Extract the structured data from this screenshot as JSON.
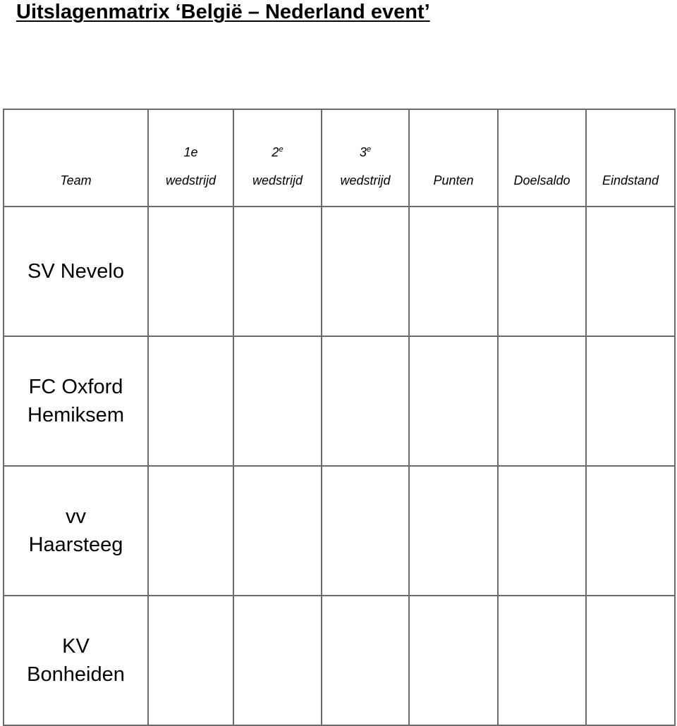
{
  "document": {
    "title": "Uitslagenmatrix ‘België – Nederland event’"
  },
  "table": {
    "headers": [
      {
        "line1": "",
        "line1_sup": "",
        "line2": "Team"
      },
      {
        "line1": "1e",
        "line1_sup": "",
        "line2": "wedstrijd"
      },
      {
        "line1": "2",
        "line1_sup": "e",
        "line2": "wedstrijd"
      },
      {
        "line1": "3",
        "line1_sup": "e",
        "line2": "wedstrijd"
      },
      {
        "line1": "",
        "line1_sup": "",
        "line2": "Punten"
      },
      {
        "line1": "",
        "line1_sup": "",
        "line2": "Doelsaldo"
      },
      {
        "line1": "",
        "line1_sup": "",
        "line2": "Eindstand"
      }
    ],
    "rows": [
      {
        "team_line1": "SV Nevelo",
        "team_line2": "",
        "cells": [
          "",
          "",
          "",
          "",
          "",
          ""
        ]
      },
      {
        "team_line1": "FC Oxford",
        "team_line2": "Hemiksem",
        "cells": [
          "",
          "",
          "",
          "",
          "",
          ""
        ]
      },
      {
        "team_line1": "vv",
        "team_line2": "Haarsteeg",
        "cells": [
          "",
          "",
          "",
          "",
          "",
          ""
        ]
      },
      {
        "team_line1": "KV",
        "team_line2": "Bonheiden",
        "cells": [
          "",
          "",
          "",
          "",
          "",
          ""
        ]
      }
    ]
  }
}
